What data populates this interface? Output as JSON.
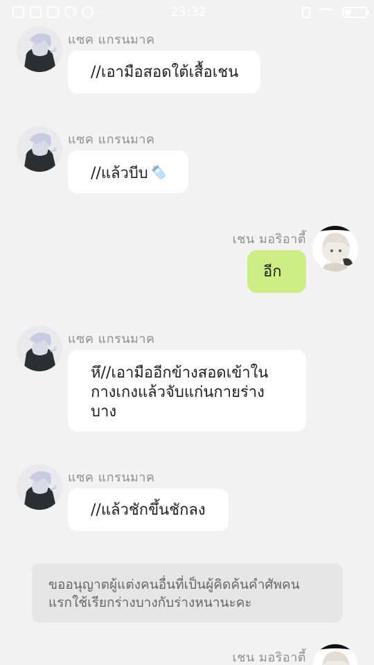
{
  "status_bar": {
    "time": "23:32",
    "icon_names": [
      "gallery-icon",
      "calendar-icon",
      "calendar-icon",
      "app-icon",
      "messenger-icon"
    ],
    "more_label": "···",
    "battery_level": 0.3
  },
  "messages": [
    {
      "side": "left",
      "sender": "แซค แกรนมาค",
      "text": "//เอามือสอดใต้เสื้อเชน"
    },
    {
      "side": "left",
      "sender": "แซค แกรนมาค",
      "text": "//แล้วบีบ",
      "emoji": "baby-bottle-icon"
    },
    {
      "side": "right",
      "sender": "เชน มอริอาตี้",
      "text": "อีก"
    },
    {
      "side": "left",
      "sender": "แซค แกรนมาค",
      "text": "หึ//เอามืออีกข้างสอดเข้าใน\nกางเกงแล้วจับแก่นกายร่าง\nบาง"
    },
    {
      "side": "left",
      "sender": "แซค แกรนมาค",
      "text": "//แล้วชักขึ้นชักลง"
    },
    {
      "side": "right",
      "sender": "เชน มอริอาตี้",
      "text": ""
    }
  ],
  "notice": {
    "text": "ขออนุญาตผู้แต่งคนอื่นที่เป็นผู้คิดค้นคำศัพคน\nแรกใช้เรียกร่างบางกับร่างหนานะคะ"
  },
  "colors": {
    "background": "#f2f2f2",
    "bubble_left": "#ffffff",
    "bubble_right": "#cdee86",
    "name_text": "#8f8f8f",
    "notice_bg": "#e6e6e6"
  }
}
